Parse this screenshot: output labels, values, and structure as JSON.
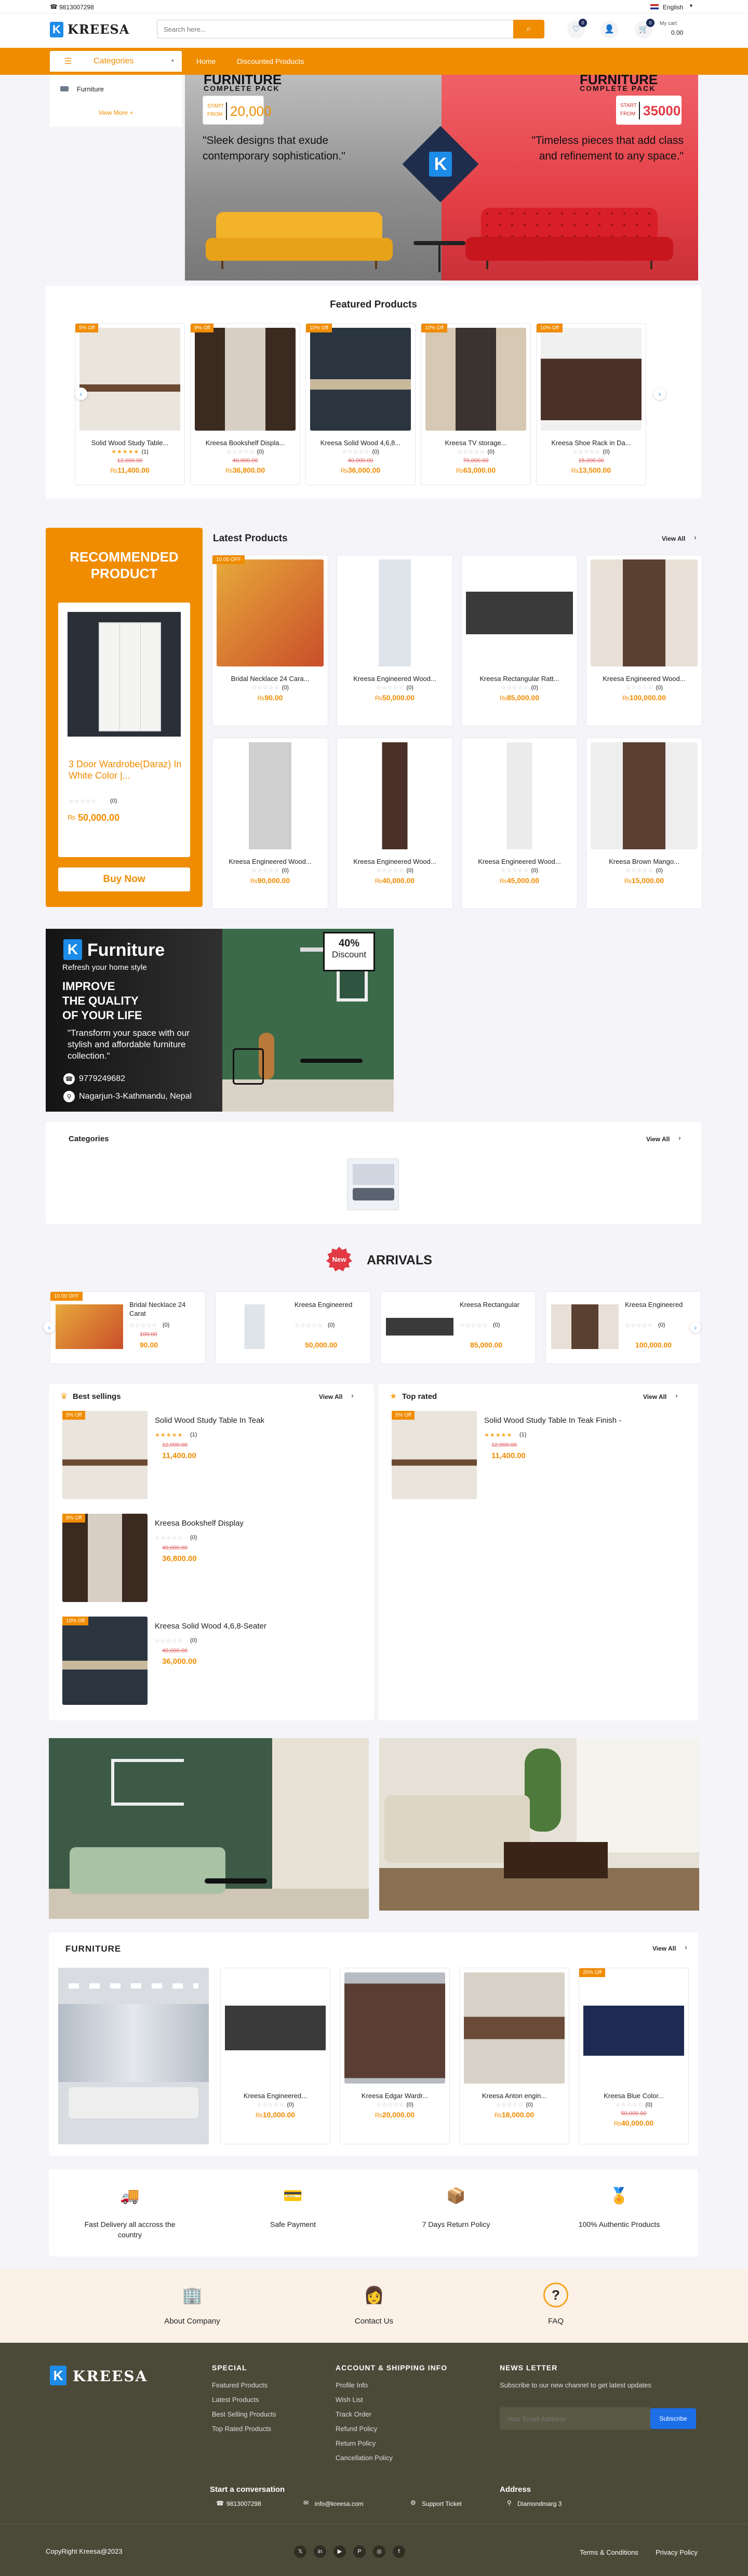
{
  "topbar": {
    "phone": "9813007298",
    "language": "English"
  },
  "header": {
    "logo": "KREESA",
    "search_placeholder": "Search here...",
    "wishlist_count": "0",
    "cart_label": "My cart",
    "cart_total": "0.00"
  },
  "nav": {
    "categories": "Categories",
    "items": [
      "Home",
      "Discounted Products"
    ]
  },
  "categories_menu": {
    "item": "Furniture",
    "more": "View More +"
  },
  "hero": {
    "left_title": "FURNITURE",
    "left_sub": "COMPLETE PACK",
    "left_start": "START\nFROM",
    "left_price": "20,000",
    "left_quote": "\"Sleek designs that exude contemporary sophistication.\"",
    "right_title": "FURNITURE",
    "right_sub": "COMPLETE PACK",
    "right_start": "START\nFROM",
    "right_price": "35000",
    "right_quote": "\"Timeless pieces that add class and refinement to any space.\""
  },
  "featured": {
    "title": "Featured Products",
    "items": [
      {
        "badge": "5% Off",
        "name": "Solid Wood Study Table...",
        "rating": "(1)",
        "old": "12,000.00",
        "price": "11,400.00"
      },
      {
        "badge": "8% Off",
        "name": "Kreesa Bookshelf Displa...",
        "rating": "(0)",
        "old": "40,000.00",
        "price": "36,800.00"
      },
      {
        "badge": "10% Off",
        "name": "Kreesa Solid Wood 4,6,8...",
        "rating": "(0)",
        "old": "40,000.00",
        "price": "36,000.00"
      },
      {
        "badge": "10% Off",
        "name": "Kreesa TV storage...",
        "rating": "(0)",
        "old": "70,000.00",
        "price": "63,000.00"
      },
      {
        "badge": "10% Off",
        "name": "Kreesa Shoe Rack in Da...",
        "rating": "(0)",
        "old": "15,000.00",
        "price": "13,500.00"
      }
    ]
  },
  "recommended": {
    "title": "RECOMMENDED PRODUCT",
    "name": "3 Door Wardrobe(Daraz) In White Color |...",
    "rating": "(0)",
    "price": "50,000.00",
    "button": "Buy Now"
  },
  "latest": {
    "title": "Latest Products",
    "view_all": "View All",
    "items": [
      {
        "badge": "10.00 OFF",
        "name": "Bridal Necklace 24 Cara...",
        "rating": "(0)",
        "old": "",
        "price": "90.00"
      },
      {
        "badge": "",
        "name": "Kreesa Engineered Wood...",
        "rating": "(0)",
        "old": "",
        "price": "50,000.00"
      },
      {
        "badge": "",
        "name": "Kreesa Rectangular Ratt...",
        "rating": "(0)",
        "old": "",
        "price": "85,000.00"
      },
      {
        "badge": "",
        "name": "Kreesa Engineered Wood...",
        "rating": "(0)",
        "old": "",
        "price": "100,000.00"
      },
      {
        "badge": "",
        "name": "Kreesa Engineered Wood...",
        "rating": "(0)",
        "old": "",
        "price": "90,000.00"
      },
      {
        "badge": "",
        "name": "Kreesa Engineered Wood...",
        "rating": "(0)",
        "old": "",
        "price": "40,000.00"
      },
      {
        "badge": "",
        "name": "Kreesa Engineered Wood...",
        "rating": "(0)",
        "old": "",
        "price": "45,000.00"
      },
      {
        "badge": "",
        "name": "Kreesa Brown Mango...",
        "rating": "(0)",
        "old": "",
        "price": "15,000.00"
      }
    ]
  },
  "promo": {
    "brand": "Furniture",
    "tagline": "Refresh your home style",
    "headline1": "IMPROVE",
    "headline2": "THE QUALITY",
    "headline3": "OF YOUR LIFE",
    "quote": "\"Transform your space with our stylish and affordable furniture collection.\"",
    "phone": "9779249682",
    "address": "Nagarjun-3-Kathmandu, Nepal",
    "discount": "40%",
    "discount_label": "Discount"
  },
  "categories_section": {
    "title": "Categories",
    "view_all": "View All"
  },
  "arrivals": {
    "tag": "New",
    "title": "ARRIVALS",
    "items": [
      {
        "badge": "10.00 OFF",
        "name": "Bridal Necklace 24 Carat",
        "rating": "(0)",
        "old": "100.00",
        "price": "90.00"
      },
      {
        "badge": "",
        "name": "Kreesa Engineered",
        "rating": "(0)",
        "old": "",
        "price": "50,000.00"
      },
      {
        "badge": "",
        "name": "Kreesa Rectangular",
        "rating": "(0)",
        "old": "",
        "price": "85,000.00"
      },
      {
        "badge": "",
        "name": "Kreesa Engineered",
        "rating": "(0)",
        "old": "",
        "price": "100,000.00"
      }
    ]
  },
  "best": {
    "title": "Best sellings",
    "view_all": "View All",
    "items": [
      {
        "badge": "5% Off",
        "name": "Solid Wood Study Table In Teak",
        "rating": "(1)",
        "old": "12,000.00",
        "price": "11,400.00"
      },
      {
        "badge": "8% Off",
        "name": "Kreesa Bookshelf Display",
        "rating": "(0)",
        "old": "40,000.00",
        "price": "36,800.00"
      },
      {
        "badge": "10% Off",
        "name": "Kreesa Solid Wood 4,6,8-Seater",
        "rating": "(0)",
        "old": "40,000.00",
        "price": "36,000.00"
      }
    ]
  },
  "toprated": {
    "title": "Top rated",
    "view_all": "View All",
    "items": [
      {
        "badge": "5% Off",
        "name": "Solid Wood Study Table In Teak Finish -",
        "rating": "(1)",
        "old": "12,000.00",
        "price": "11,400.00"
      }
    ]
  },
  "furniture": {
    "title": "FURNITURE",
    "view_all": "View All",
    "items": [
      {
        "badge": "",
        "name": "Kreesa Engineered...",
        "rating": "(0)",
        "old": "",
        "price": "10,000.00"
      },
      {
        "badge": "",
        "name": "Kreesa Edgar Wardr...",
        "rating": "(0)",
        "old": "",
        "price": "20,000.00"
      },
      {
        "badge": "",
        "name": "Kreesa Anton engin...",
        "rating": "(0)",
        "old": "",
        "price": "18,000.00"
      },
      {
        "badge": "20% Off",
        "name": "Kreesa Blue Color...",
        "rating": "(0)",
        "old": "50,000.00",
        "price": "40,000.00"
      }
    ]
  },
  "features": [
    "Fast Delivery all accross the country",
    "Safe Payment",
    "7 Days Return Policy",
    "100% Authentic Products"
  ],
  "links": [
    "About Company",
    "Contact Us",
    "FAQ"
  ],
  "footer": {
    "logo": "KREESA",
    "special_title": "SPECIAL",
    "special": [
      "Featured Products",
      "Latest Products",
      "Best Selling Products",
      "Top Rated Products"
    ],
    "account_title": "ACCOUNT & SHIPPING INFO",
    "account": [
      "Profile Info",
      "Wish List",
      "Track Order",
      "Refund Policy",
      "Return Policy",
      "Cancellation Policy"
    ],
    "news_title": "NEWS LETTER",
    "news_text": "Subscribe to our new channel to get latest updates",
    "email_placeholder": "Your Email Address",
    "subscribe": "Subscribe",
    "convo_title": "Start a conversation",
    "phone": "9813007298",
    "email": "info@kreesa.com",
    "support": "Support Ticket",
    "address_title": "Address",
    "address": "Diamondmarg 3",
    "copyright": "CopyRight Kreesa@2023",
    "terms": "Terms & Conditions",
    "privacy": "Privacy Policy"
  },
  "colors": {
    "accent": "#f08c00",
    "brand_blue": "#1d8be8",
    "footer_bg": "#4b4a39"
  }
}
